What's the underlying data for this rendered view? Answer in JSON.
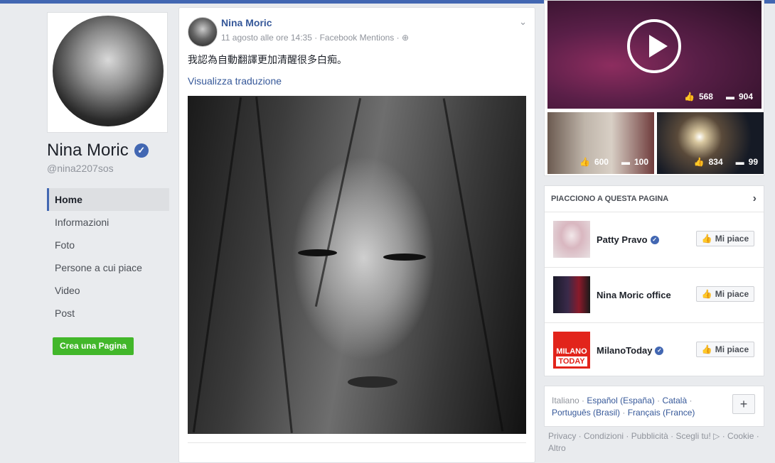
{
  "profile": {
    "name": "Nina Moric",
    "handle": "@nina2207sos"
  },
  "nav": {
    "items": [
      "Home",
      "Informazioni",
      "Foto",
      "Persone a cui piace",
      "Video",
      "Post"
    ],
    "active": "Home",
    "create_page_label": "Crea una Pagina"
  },
  "post": {
    "author": "Nina Moric",
    "date": "11 agosto alle ore 14:35",
    "source": "Facebook Mentions",
    "text": "我認為自動翻譯更加清醒很多白痴。",
    "translate_label": "Visualizza traduzione"
  },
  "media": {
    "main_video": {
      "likes": "568",
      "comments": "904"
    },
    "thumb1": {
      "likes": "600",
      "comments": "100"
    },
    "thumb2": {
      "likes": "834",
      "comments": "99"
    }
  },
  "likes_section": {
    "title": "PIACCIONO A QUESTA PAGINA",
    "button_label": "Mi piace",
    "pages": [
      {
        "name": "Patty Pravo",
        "verified": true
      },
      {
        "name": "Nina Moric office",
        "verified": false
      },
      {
        "name": "MilanoToday",
        "verified": true,
        "logo_text_1": "MILANO",
        "logo_text_2": "TODAY"
      }
    ]
  },
  "languages": {
    "current": "Italiano",
    "links": [
      "Español (España)",
      "Català",
      "Português (Brasil)",
      "Français (France)"
    ],
    "plus_label": "+"
  },
  "footer": {
    "links": [
      "Privacy",
      "Condizioni",
      "Pubblicità",
      "Scegli tu!",
      "Cookie",
      "Altro"
    ]
  },
  "colors": {
    "brand": "#4267b2",
    "link": "#365899",
    "create_button": "#42b72a"
  }
}
